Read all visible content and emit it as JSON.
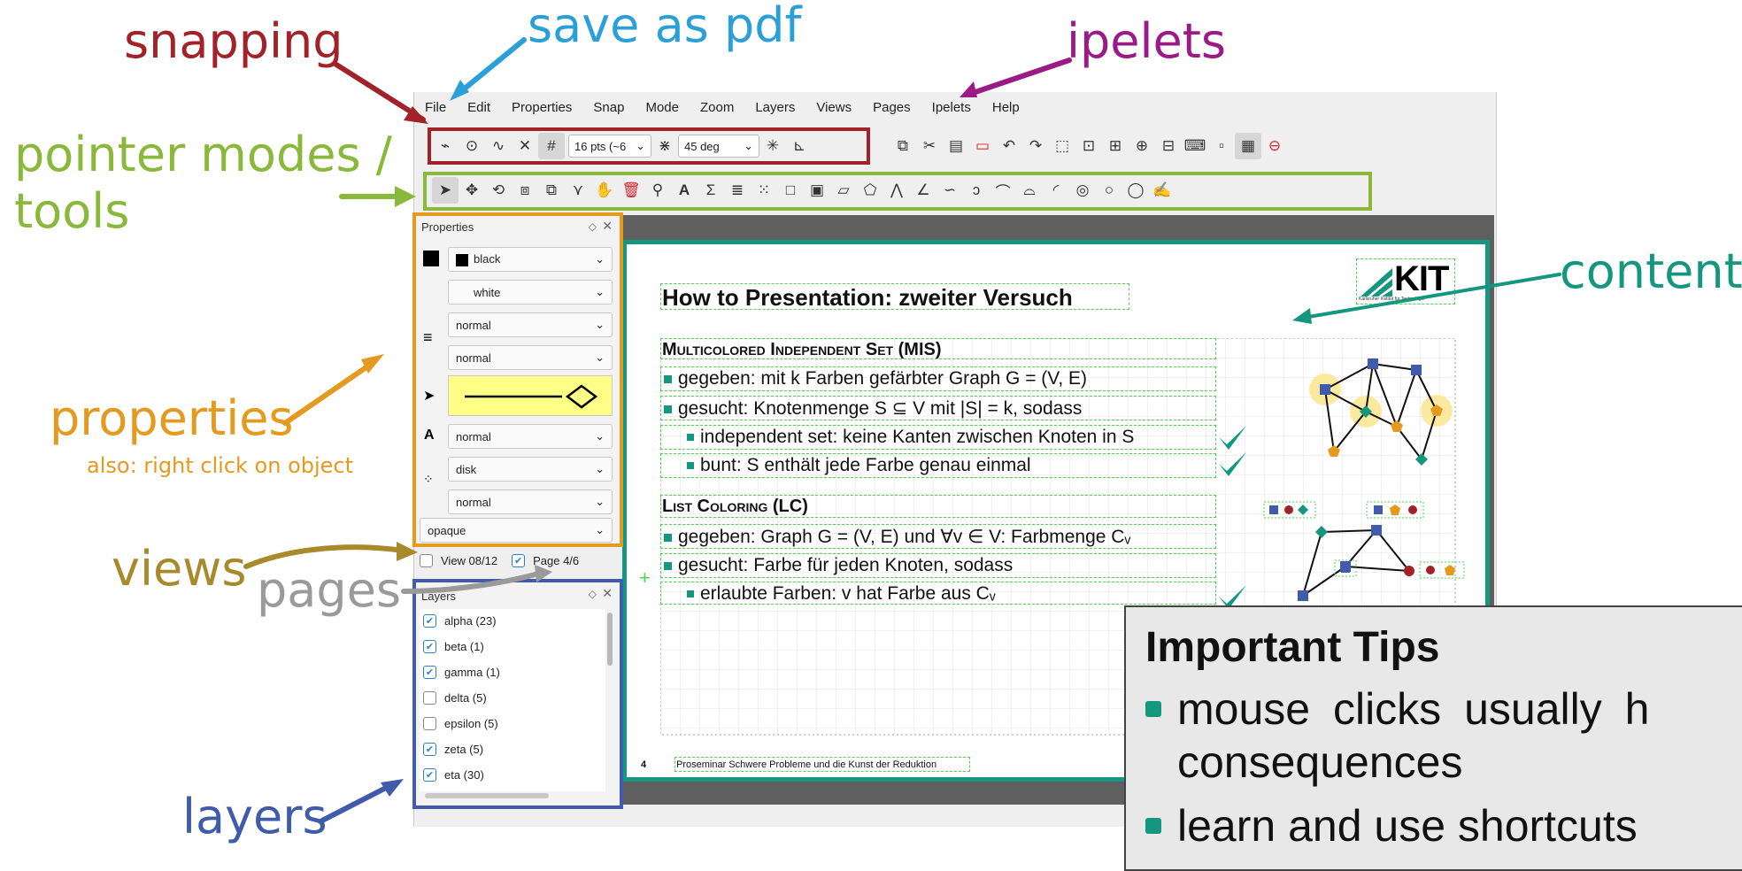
{
  "annotations": {
    "snapping": "snapping",
    "save_as_pdf": "save as pdf",
    "ipelets": "ipelets",
    "pointer_modes_1": "pointer modes /",
    "pointer_modes_2": "tools",
    "properties": "properties",
    "properties_note": "also: right click on object",
    "views": "views",
    "pages": "pages",
    "layers": "layers",
    "content": "content"
  },
  "colors": {
    "snapping": "#a2222a",
    "save_as_pdf": "#2b9fd8",
    "ipelets": "#9a1a86",
    "pointer_modes": "#8ab83a",
    "properties": "#e39a1f",
    "views": "#a88a2c",
    "pages": "#9a9a9a",
    "layers": "#3f5ba9",
    "content": "#14977e"
  },
  "menu": [
    "File",
    "Edit",
    "Properties",
    "Snap",
    "Mode",
    "Zoom",
    "Layers",
    "Views",
    "Pages",
    "Ipelets",
    "Help"
  ],
  "toolbar": {
    "grid_size": "16 pts (~6",
    "angle": "45 deg"
  },
  "properties_panel": {
    "title": "Properties",
    "stroke_color": "black",
    "fill_color": "white",
    "pen_width": "normal",
    "dash_style": "normal",
    "text_size": "normal",
    "mark_shape": "disk",
    "mark_size": "normal",
    "opacity": "opaque"
  },
  "views_pages": {
    "view": "View 08/12",
    "page": "Page 4/6"
  },
  "layers_panel": {
    "title": "Layers",
    "items": [
      {
        "label": "alpha (23)",
        "checked": true
      },
      {
        "label": "beta (1)",
        "checked": true
      },
      {
        "label": "gamma (1)",
        "checked": true
      },
      {
        "label": "delta (5)",
        "checked": false
      },
      {
        "label": "epsilon (5)",
        "checked": false
      },
      {
        "label": "zeta (5)",
        "checked": true
      },
      {
        "label": "eta (30)",
        "checked": true
      }
    ]
  },
  "slide": {
    "title": "How to Presentation: zweiter Versuch",
    "logo": "KIT",
    "logo_sub": "Karlsruher Institut für Technologie",
    "section1": "Multicolored Independent Set (MIS)",
    "s1_b1": "gegeben: mit k Farben gefärbter Graph G = (V, E)",
    "s1_b2": "gesucht: Knotenmenge S ⊆ V mit |S| = k, sodass",
    "s1_b3": "independent set: keine Kanten zwischen Knoten in S",
    "s1_b4": "bunt: S enthält jede Farbe genau einmal",
    "section2": "List Coloring (LC)",
    "s2_b1": "gegeben: Graph G = (V, E) und ∀v ∈ V: Farbmenge Cᵥ",
    "s2_b2": "gesucht: Farbe für jeden Knoten, sodass",
    "s2_b3": "erlaubte Farben: v hat Farbe aus Cᵥ",
    "page_number": "4",
    "footer": "Proseminar Schwere Probleme und die Kunst der Reduktion"
  },
  "tips": {
    "title": "Important Tips",
    "item1a": "mouse clicks usually h",
    "item1b": "consequences",
    "item2": "learn and use shortcuts"
  }
}
